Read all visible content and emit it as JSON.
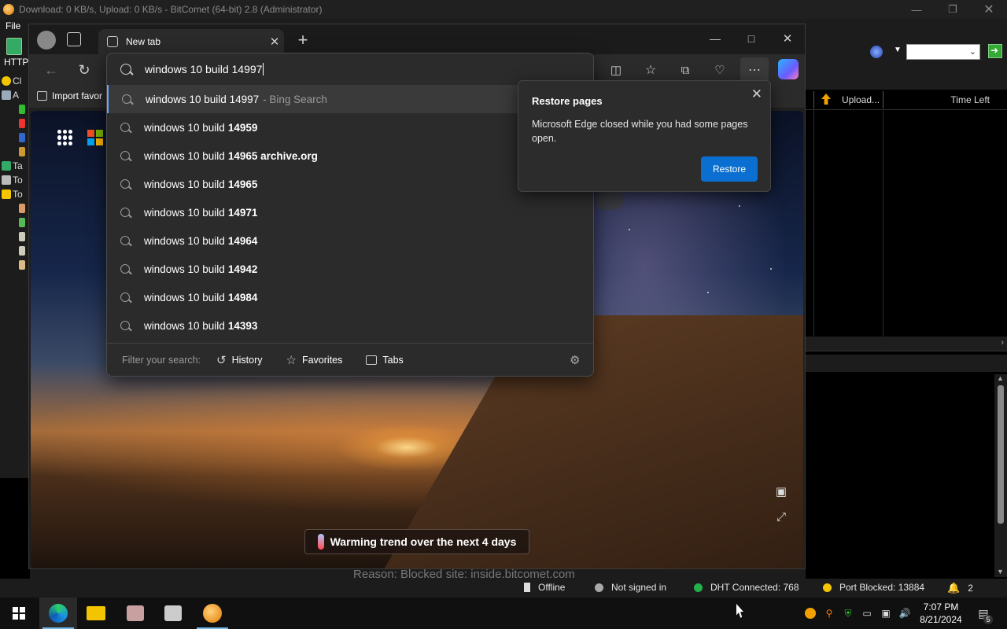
{
  "bitcomet": {
    "title": "Download: 0 KB/s, Upload: 0 KB/s - BitComet (64-bit) 2.8 (Administrator)",
    "menu_file": "File",
    "left_http": "HTTP",
    "tree_items": [
      "Cl",
      "A",
      "",
      "",
      "",
      "",
      "Ta",
      "To",
      "To"
    ],
    "col_upload": "Upload...",
    "col_time_left": "Time Left",
    "reason_text": "Reason: Blocked site: inside.bitcomet.com",
    "status": {
      "offline": "Offline",
      "signin": "Not signed in",
      "dht": "DHT Connected: 768",
      "port": "Port Blocked: 13884",
      "notif_count": "2"
    }
  },
  "edge": {
    "tab_label": "New tab",
    "address_value": "windows 10 build 14997",
    "favbar_import": "Import favor",
    "suggestions": [
      {
        "prefix": "windows 10 build 14997",
        "bold": "",
        "suffix": "- Bing Search"
      },
      {
        "prefix": "windows 10 build",
        "bold": "14959",
        "suffix": ""
      },
      {
        "prefix": "windows 10 build",
        "bold": "14965 archive.org",
        "suffix": ""
      },
      {
        "prefix": "windows 10 build",
        "bold": "14965",
        "suffix": ""
      },
      {
        "prefix": "windows 10 build",
        "bold": "14971",
        "suffix": ""
      },
      {
        "prefix": "windows 10 build",
        "bold": "14964",
        "suffix": ""
      },
      {
        "prefix": "windows 10 build",
        "bold": "14942",
        "suffix": ""
      },
      {
        "prefix": "windows 10 build",
        "bold": "14984",
        "suffix": ""
      },
      {
        "prefix": "windows 10 build",
        "bold": "14393",
        "suffix": ""
      }
    ],
    "filter_label": "Filter your search:",
    "filter_history": "History",
    "filter_favorites": "Favorites",
    "filter_tabs": "Tabs",
    "restore": {
      "title": "Restore pages",
      "body": "Microsoft Edge closed while you had some pages open.",
      "button": "Restore"
    },
    "weather": "Warming trend over the next 4 days"
  },
  "taskbar": {
    "time": "7:07 PM",
    "date": "8/21/2024",
    "action_center_count": "5"
  },
  "colors": {
    "accent_blue": "#0a6fd1",
    "dht_green": "#22b14c",
    "port_yellow": "#f2c500",
    "taskbar_indicator": "#76b9ed"
  }
}
